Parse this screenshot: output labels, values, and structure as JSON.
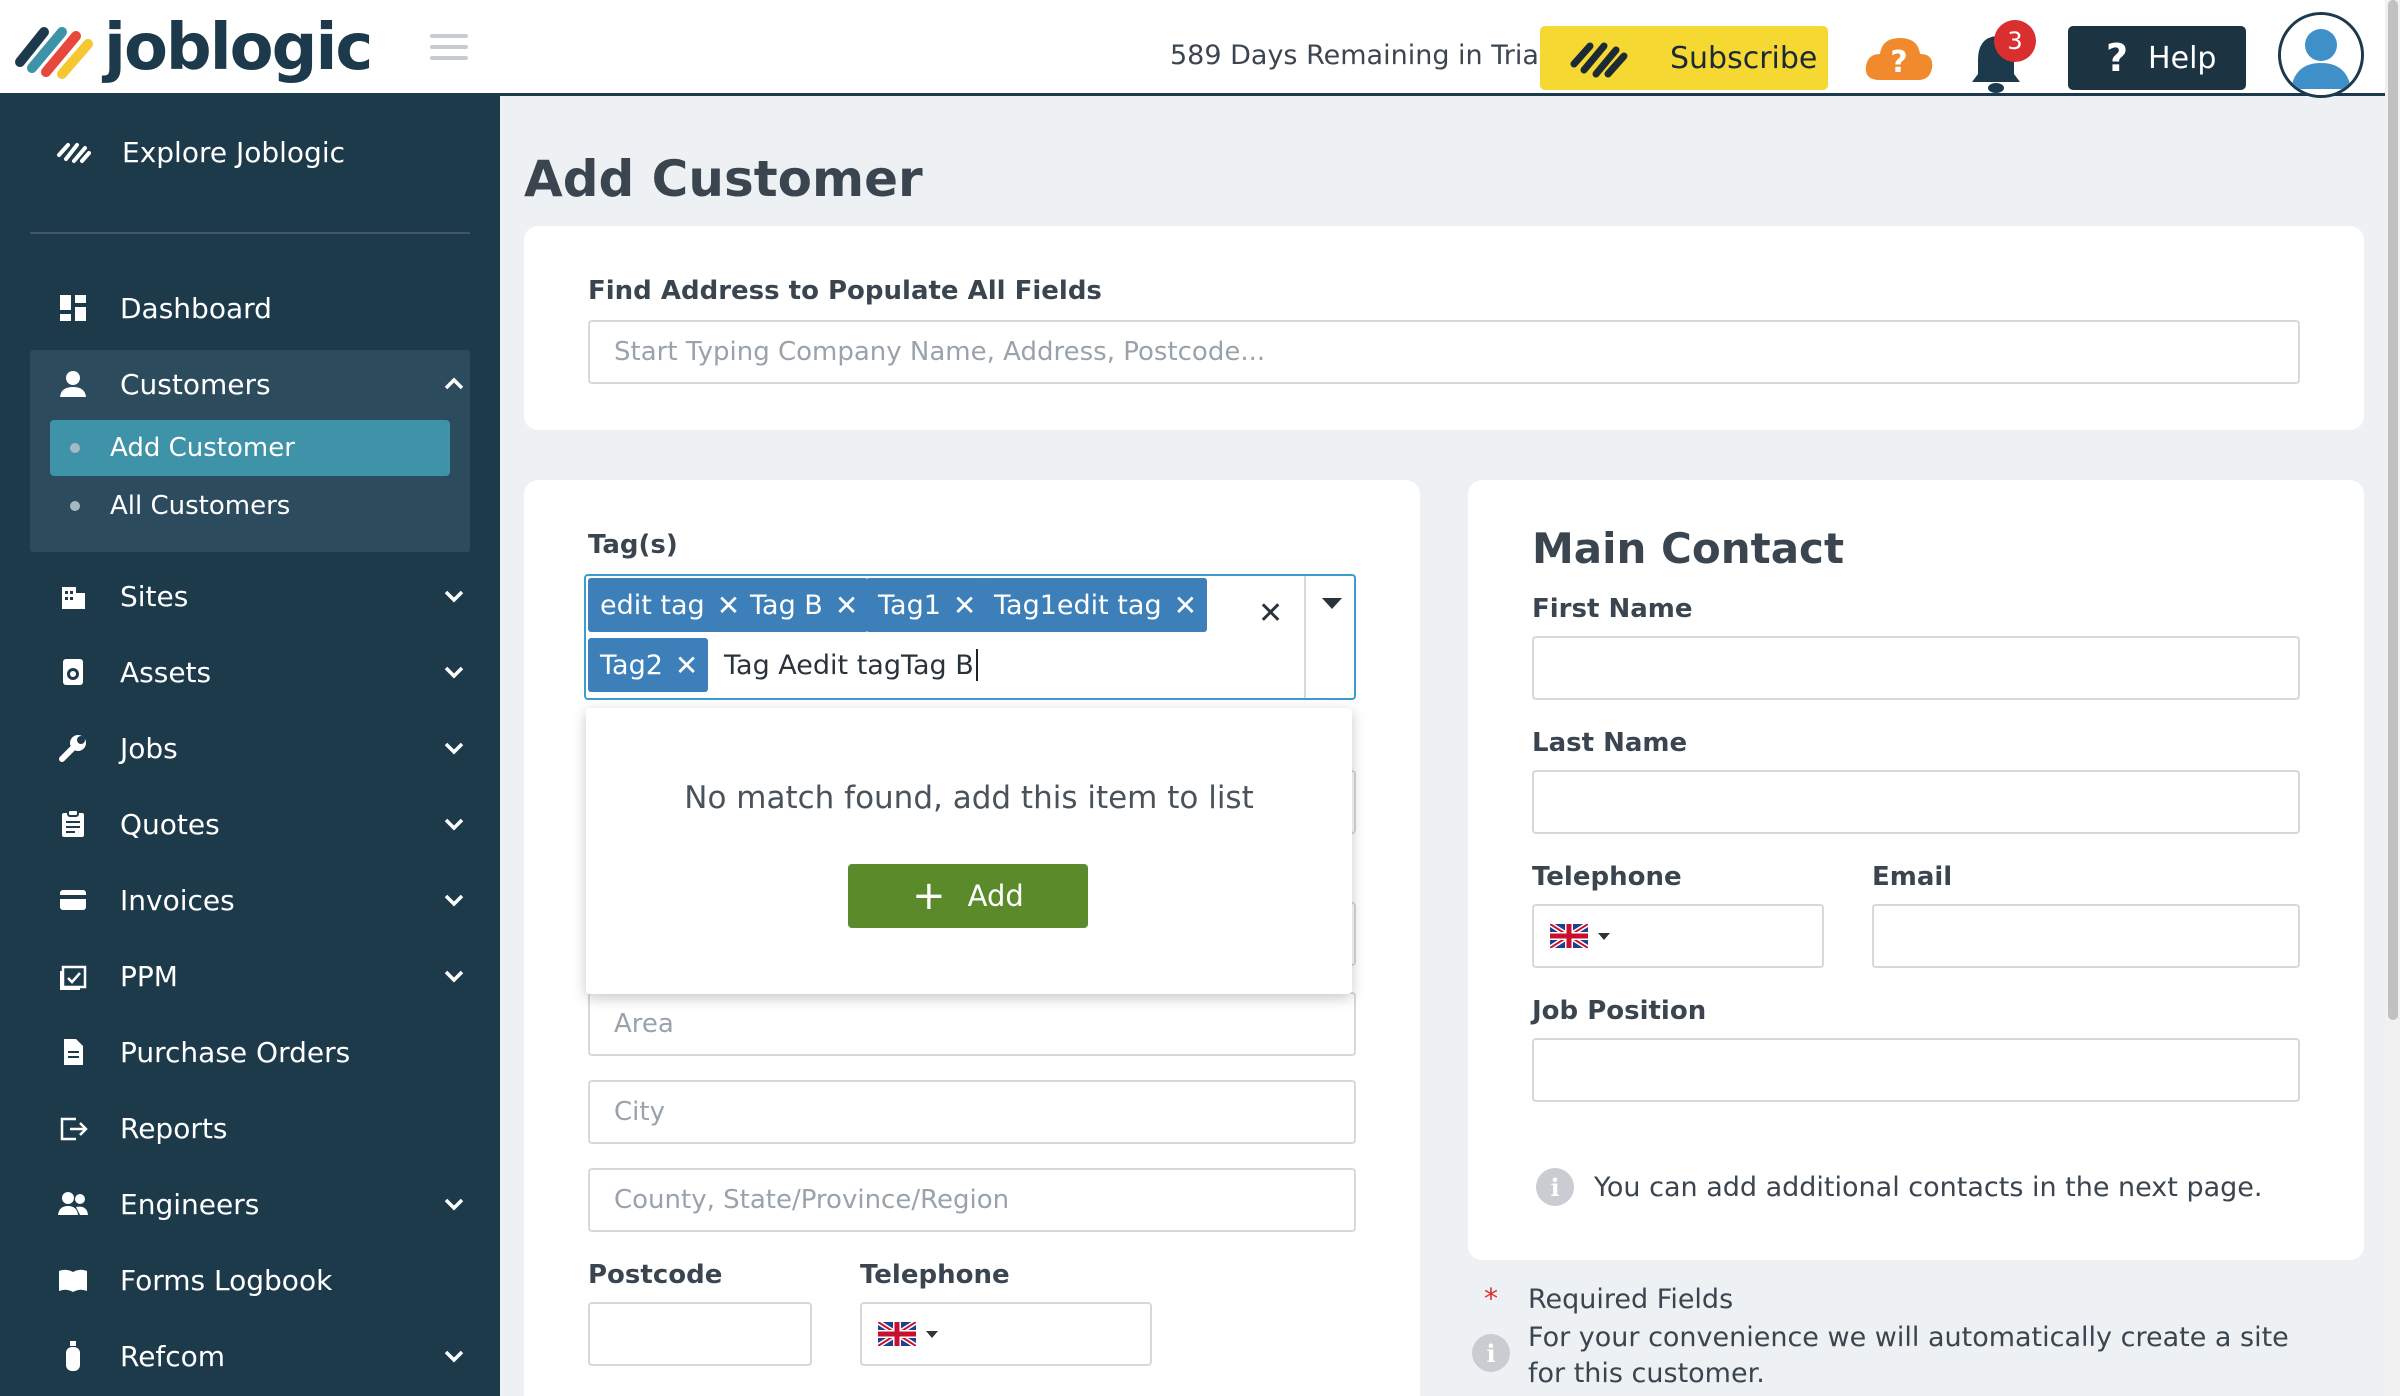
{
  "header": {
    "logo_text": "joblogic",
    "trial_text": "589 Days Remaining in Trial",
    "subscribe_label": "Subscribe",
    "notifications_count": "3",
    "help_label": "Help"
  },
  "sidebar": {
    "explore_label": "Explore Joblogic",
    "items": [
      {
        "label": "Dashboard",
        "icon": "dashboard-icon"
      },
      {
        "label": "Customers",
        "icon": "person-icon",
        "expanded": true
      },
      {
        "label": "Sites",
        "icon": "building-icon"
      },
      {
        "label": "Assets",
        "icon": "asset-icon"
      },
      {
        "label": "Jobs",
        "icon": "wrench-icon"
      },
      {
        "label": "Quotes",
        "icon": "clipboard-icon"
      },
      {
        "label": "Invoices",
        "icon": "card-icon"
      },
      {
        "label": "PPM",
        "icon": "calendar-check-icon"
      },
      {
        "label": "Purchase Orders",
        "icon": "document-icon"
      },
      {
        "label": "Reports",
        "icon": "export-icon"
      },
      {
        "label": "Engineers",
        "icon": "people-icon"
      },
      {
        "label": "Forms Logbook",
        "icon": "book-icon"
      },
      {
        "label": "Refcom",
        "icon": "cylinder-icon"
      }
    ],
    "customers_sub": [
      {
        "label": "Add Customer",
        "active": true
      },
      {
        "label": "All Customers"
      }
    ]
  },
  "main": {
    "title": "Add Customer",
    "find_address": {
      "label": "Find Address to Populate All Fields",
      "placeholder": "Start Typing Company Name, Address, Postcode..."
    },
    "tags": {
      "label": "Tag(s)",
      "selected": [
        "edit tag",
        "Tag B",
        "Tag1",
        "Tag1edit tag",
        "Tag2"
      ],
      "typed_value": "Tag Aedit tagTag B",
      "dropdown_message": "No match found, add this item to list",
      "add_label": "Add"
    },
    "address": {
      "area_placeholder": "Area",
      "city_placeholder": "City",
      "county_placeholder": "County, State/Province/Region",
      "postcode_label": "Postcode",
      "telephone_label": "Telephone"
    },
    "main_contact": {
      "title": "Main Contact",
      "first_name_label": "First Name",
      "last_name_label": "Last Name",
      "telephone_label": "Telephone",
      "email_label": "Email",
      "job_position_label": "Job Position",
      "info_text": "You can add additional contacts in the next page."
    },
    "footer_notes": {
      "required_label": "Required Fields",
      "site_note": "For your convenience we will automatically create a site for this customer."
    }
  },
  "colors": {
    "sidebar_bg": "#1d3a4b",
    "active_item": "#3e93a8",
    "tag_bg": "#3d7fb8",
    "add_button": "#5a8a2a",
    "subscribe_bg": "#f5d832"
  }
}
